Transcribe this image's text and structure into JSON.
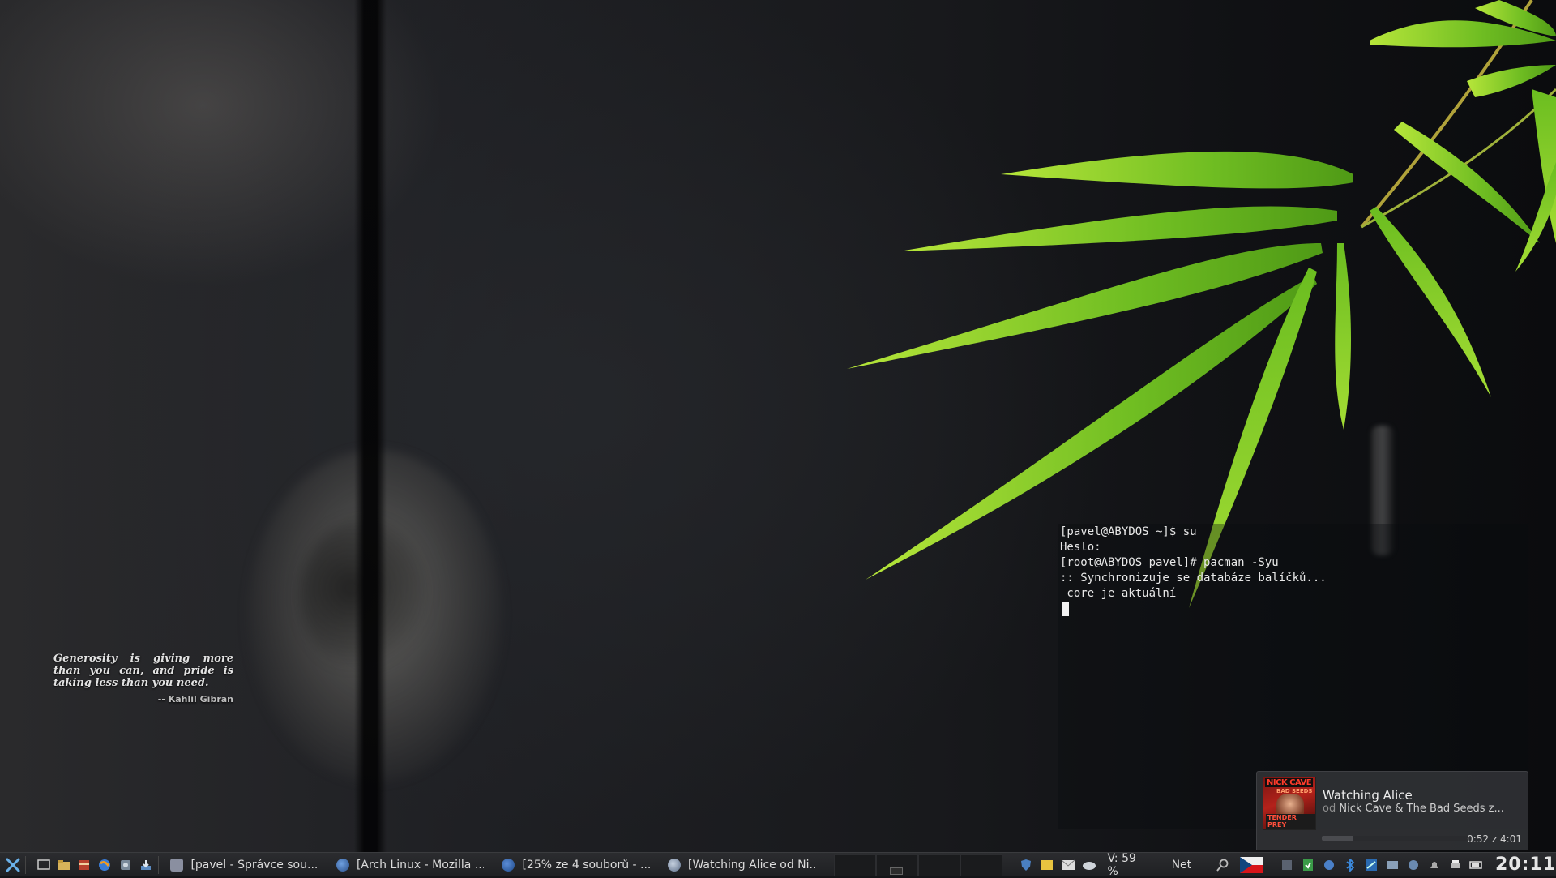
{
  "desktop": {
    "quote": {
      "text": "Generosity is giving more than you can, and pride is taking less than you need.",
      "author": "-- Kahlil Gibran"
    }
  },
  "terminal": {
    "lines": [
      "[pavel@ABYDOS ~]$ su",
      "Heslo:",
      "[root@ABYDOS pavel]# pacman -Syu",
      ":: Synchronizuje se databáze balíčků...",
      " core je aktuální"
    ]
  },
  "notification": {
    "title": "Watching Alice",
    "artist_prefix": "od",
    "artist": "Nick Cave & The Bad Seeds z...",
    "time": "0:52 z 4:01",
    "progress": 0.216,
    "album_art": {
      "top": "NICK CAVE",
      "middle": "BAD SEEDS",
      "bottom": "TENDER PREY"
    }
  },
  "taskbar": {
    "launchers": [
      "menu-icon",
      "show-desktop-icon",
      "file-manager-icon",
      "archive-icon",
      "browser-icon",
      "settings-icon",
      "download-icon"
    ],
    "tasks": [
      {
        "label": "[pavel - Správce sou...",
        "icon": "file-manager-icon",
        "color": "#8a8fa0"
      },
      {
        "label": "[Arch Linux - Mozilla ...",
        "icon": "firefox-icon",
        "color": "#3a5f9a"
      },
      {
        "label": "[25% ze 4 souborů - ...",
        "icon": "download-icon",
        "color": "#2d5fa8"
      },
      {
        "label": "[Watching Alice od Ni...",
        "icon": "music-player-icon",
        "color": "#7b8ba6"
      }
    ],
    "volume": "V: 59 %",
    "network": "Net",
    "clock": "20:11"
  }
}
